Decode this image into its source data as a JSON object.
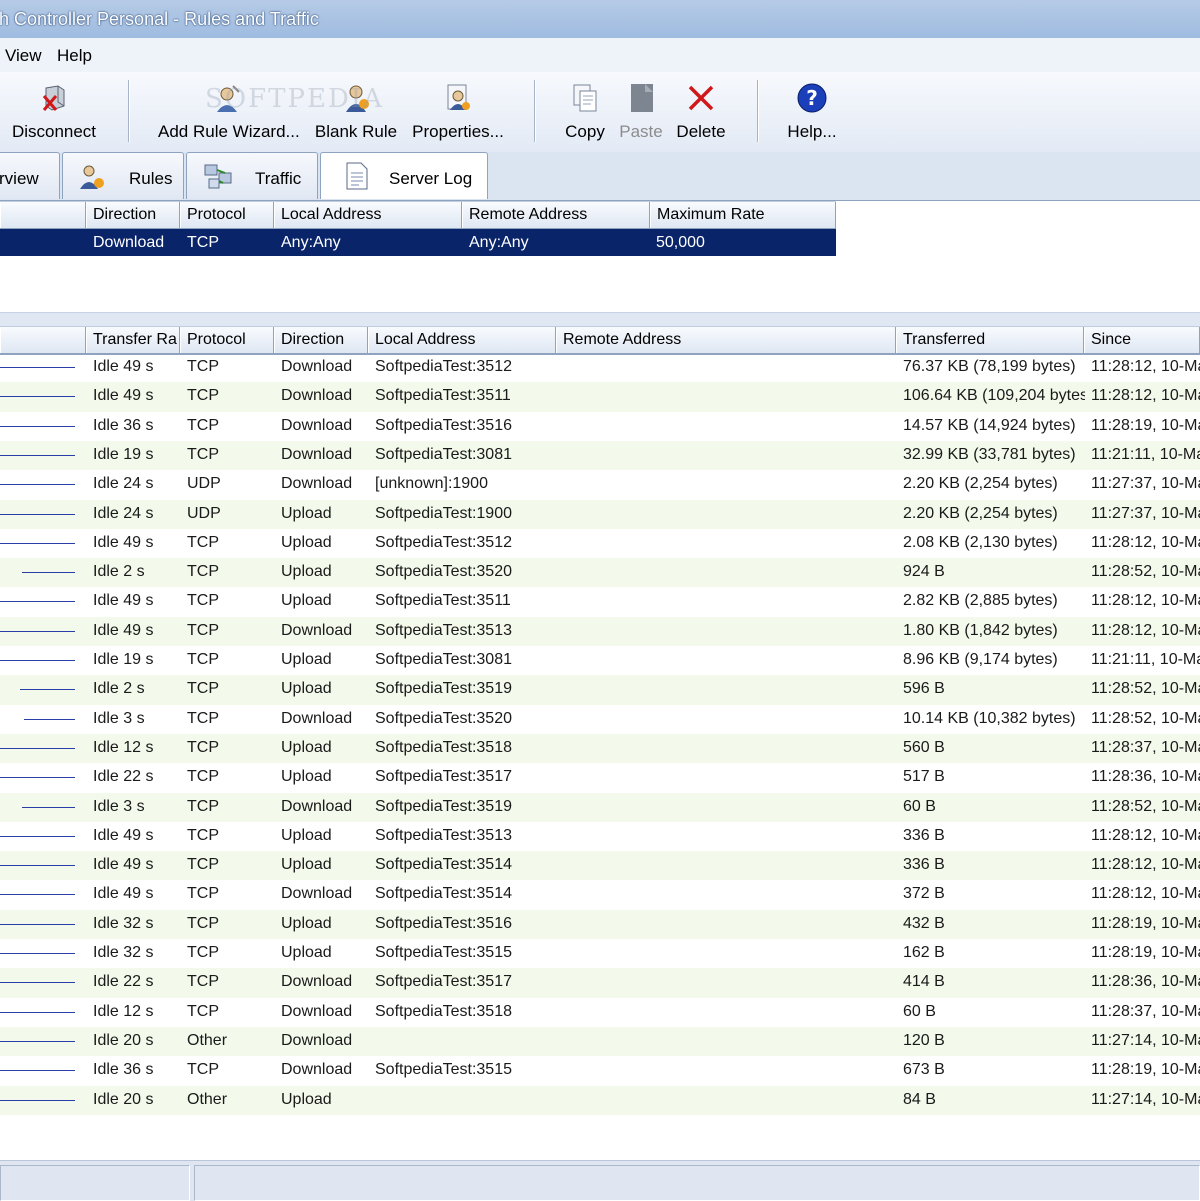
{
  "window": {
    "title": "th Controller Personal - Rules and Traffic"
  },
  "menu": {
    "items": [
      "View",
      "Help"
    ]
  },
  "toolbar": {
    "disconnect": "Disconnect",
    "add_rule_wizard": "Add Rule Wizard...",
    "blank_rule": "Blank Rule",
    "properties": "Properties...",
    "copy": "Copy",
    "paste": "Paste",
    "delete": "Delete",
    "help": "Help...",
    "watermark": "SOFTPEDIA"
  },
  "tabs": {
    "overview": "rview",
    "rules": "Rules",
    "traffic": "Traffic",
    "server_log": "Server Log"
  },
  "rules_grid": {
    "headers": [
      "Direction",
      "Protocol",
      "Local Address",
      "Remote Address",
      "Maximum Rate"
    ],
    "rows": [
      {
        "direction": "Download",
        "protocol": "TCP",
        "local": "Any:Any",
        "remote": "Any:Any",
        "rate": "50,000"
      }
    ]
  },
  "traffic_grid": {
    "headers": [
      "Transfer Ra",
      "Protocol",
      "Direction",
      "Local Address",
      "Remote Address",
      "Transferred",
      "Since"
    ],
    "rows": [
      {
        "rate": "Idle 49 s",
        "protocol": "TCP",
        "direction": "Download",
        "local": "SoftpediaTest:3512",
        "remote": "",
        "transferred": "76.37 KB (78,199 bytes)",
        "since": "11:28:12, 10-Ma"
      },
      {
        "rate": "Idle 49 s",
        "protocol": "TCP",
        "direction": "Download",
        "local": "SoftpediaTest:3511",
        "remote": "",
        "transferred": "106.64 KB (109,204 bytes",
        "since": "11:28:12, 10-Ma"
      },
      {
        "rate": "Idle 36 s",
        "protocol": "TCP",
        "direction": "Download",
        "local": "SoftpediaTest:3516",
        "remote": "",
        "transferred": "14.57 KB (14,924 bytes)",
        "since": "11:28:19, 10-Ma"
      },
      {
        "rate": "Idle 19 s",
        "protocol": "TCP",
        "direction": "Download",
        "local": "SoftpediaTest:3081",
        "remote": "",
        "transferred": "32.99 KB (33,781 bytes)",
        "since": "11:21:11, 10-Ma"
      },
      {
        "rate": "Idle 24 s",
        "protocol": "UDP",
        "direction": "Download",
        "local": "[unknown]:1900",
        "remote": "",
        "transferred": "2.20 KB (2,254 bytes)",
        "since": "11:27:37, 10-Ma"
      },
      {
        "rate": "Idle 24 s",
        "protocol": "UDP",
        "direction": "Upload",
        "local": "SoftpediaTest:1900",
        "remote": "",
        "transferred": "2.20 KB (2,254 bytes)",
        "since": "11:27:37, 10-Ma"
      },
      {
        "rate": "Idle 49 s",
        "protocol": "TCP",
        "direction": "Upload",
        "local": "SoftpediaTest:3512",
        "remote": "",
        "transferred": "2.08 KB (2,130 bytes)",
        "since": "11:28:12, 10-Ma"
      },
      {
        "rate": "Idle 2 s",
        "protocol": "TCP",
        "direction": "Upload",
        "local": "SoftpediaTest:3520",
        "remote": "",
        "transferred": "924 B",
        "since": "11:28:52, 10-Ma"
      },
      {
        "rate": "Idle 49 s",
        "protocol": "TCP",
        "direction": "Upload",
        "local": "SoftpediaTest:3511",
        "remote": "",
        "transferred": "2.82 KB (2,885 bytes)",
        "since": "11:28:12, 10-Ma"
      },
      {
        "rate": "Idle 49 s",
        "protocol": "TCP",
        "direction": "Download",
        "local": "SoftpediaTest:3513",
        "remote": "",
        "transferred": "1.80 KB (1,842 bytes)",
        "since": "11:28:12, 10-Ma"
      },
      {
        "rate": "Idle 19 s",
        "protocol": "TCP",
        "direction": "Upload",
        "local": "SoftpediaTest:3081",
        "remote": "",
        "transferred": "8.96 KB (9,174 bytes)",
        "since": "11:21:11, 10-Ma"
      },
      {
        "rate": "Idle 2 s",
        "protocol": "TCP",
        "direction": "Upload",
        "local": "SoftpediaTest:3519",
        "remote": "",
        "transferred": "596 B",
        "since": "11:28:52, 10-Ma"
      },
      {
        "rate": "Idle 3 s",
        "protocol": "TCP",
        "direction": "Download",
        "local": "SoftpediaTest:3520",
        "remote": "",
        "transferred": "10.14 KB (10,382 bytes)",
        "since": "11:28:52, 10-Ma"
      },
      {
        "rate": "Idle 12 s",
        "protocol": "TCP",
        "direction": "Upload",
        "local": "SoftpediaTest:3518",
        "remote": "",
        "transferred": "560 B",
        "since": "11:28:37, 10-Ma"
      },
      {
        "rate": "Idle 22 s",
        "protocol": "TCP",
        "direction": "Upload",
        "local": "SoftpediaTest:3517",
        "remote": "",
        "transferred": "517 B",
        "since": "11:28:36, 10-Ma"
      },
      {
        "rate": "Idle 3 s",
        "protocol": "TCP",
        "direction": "Download",
        "local": "SoftpediaTest:3519",
        "remote": "",
        "transferred": "60 B",
        "since": "11:28:52, 10-Ma"
      },
      {
        "rate": "Idle 49 s",
        "protocol": "TCP",
        "direction": "Upload",
        "local": "SoftpediaTest:3513",
        "remote": "",
        "transferred": "336 B",
        "since": "11:28:12, 10-Ma"
      },
      {
        "rate": "Idle 49 s",
        "protocol": "TCP",
        "direction": "Upload",
        "local": "SoftpediaTest:3514",
        "remote": "",
        "transferred": "336 B",
        "since": "11:28:12, 10-Ma"
      },
      {
        "rate": "Idle 49 s",
        "protocol": "TCP",
        "direction": "Download",
        "local": "SoftpediaTest:3514",
        "remote": "",
        "transferred": "372 B",
        "since": "11:28:12, 10-Ma"
      },
      {
        "rate": "Idle 32 s",
        "protocol": "TCP",
        "direction": "Upload",
        "local": "SoftpediaTest:3516",
        "remote": "",
        "transferred": "432 B",
        "since": "11:28:19, 10-Ma"
      },
      {
        "rate": "Idle 32 s",
        "protocol": "TCP",
        "direction": "Upload",
        "local": "SoftpediaTest:3515",
        "remote": "",
        "transferred": "162 B",
        "since": "11:28:19, 10-Ma"
      },
      {
        "rate": "Idle 22 s",
        "protocol": "TCP",
        "direction": "Download",
        "local": "SoftpediaTest:3517",
        "remote": "",
        "transferred": "414 B",
        "since": "11:28:36, 10-Ma"
      },
      {
        "rate": "Idle 12 s",
        "protocol": "TCP",
        "direction": "Download",
        "local": "SoftpediaTest:3518",
        "remote": "",
        "transferred": "60 B",
        "since": "11:28:37, 10-Ma"
      },
      {
        "rate": "Idle 20 s",
        "protocol": "Other",
        "direction": "Download",
        "local": "",
        "remote": "",
        "transferred": "120 B",
        "since": "11:27:14, 10-Ma"
      },
      {
        "rate": "Idle 36 s",
        "protocol": "TCP",
        "direction": "Download",
        "local": "SoftpediaTest:3515",
        "remote": "",
        "transferred": "673 B",
        "since": "11:28:19, 10-Ma"
      },
      {
        "rate": "Idle 20 s",
        "protocol": "Other",
        "direction": "Upload",
        "local": "",
        "remote": "",
        "transferred": "84 B",
        "since": "11:27:14, 10-Ma"
      }
    ]
  },
  "colors": {
    "selection": "#0a246a",
    "graph_line": "#2a3ea8",
    "alt_row": "#f3faec"
  }
}
